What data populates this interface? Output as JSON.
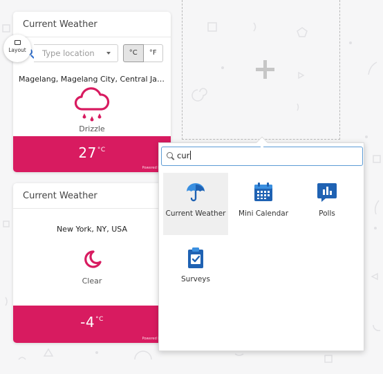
{
  "widgets": [
    {
      "title": "Current Weather",
      "location_placeholder": "Type location",
      "unit_celsius": "°C",
      "unit_fahrenheit": "°F",
      "location": "Magelang, Magelang City, Central Java, I...",
      "condition": "Drizzle",
      "condition_icon": "drizzle-cloud-icon",
      "temperature": "27",
      "temp_unit": "°C",
      "powered_by": "Powered by Da"
    },
    {
      "title": "Current Weather",
      "location": "New York, NY, USA",
      "condition": "Clear",
      "condition_icon": "crescent-moon-icon",
      "temperature": "-4",
      "temp_unit": "°C",
      "powered_by": "Powered by Da"
    }
  ],
  "layout_button": {
    "label": "Layout",
    "icon": "layout-icon"
  },
  "empty_slot": {
    "icon": "add-plus-icon"
  },
  "picker": {
    "search_value": "cur",
    "items": [
      {
        "label": "Current Weather",
        "icon": "umbrella-icon",
        "selected": true
      },
      {
        "label": "Mini Calendar",
        "icon": "calendar-icon",
        "selected": false
      },
      {
        "label": "Polls",
        "icon": "poll-chart-icon",
        "selected": false
      },
      {
        "label": "Surveys",
        "icon": "clipboard-check-icon",
        "selected": false
      }
    ]
  },
  "colors": {
    "accent_pink": "#d81b60",
    "icon_blue": "#1f62b3",
    "icon_blue_light": "#3a8fe0",
    "background": "#f6f6f7"
  }
}
